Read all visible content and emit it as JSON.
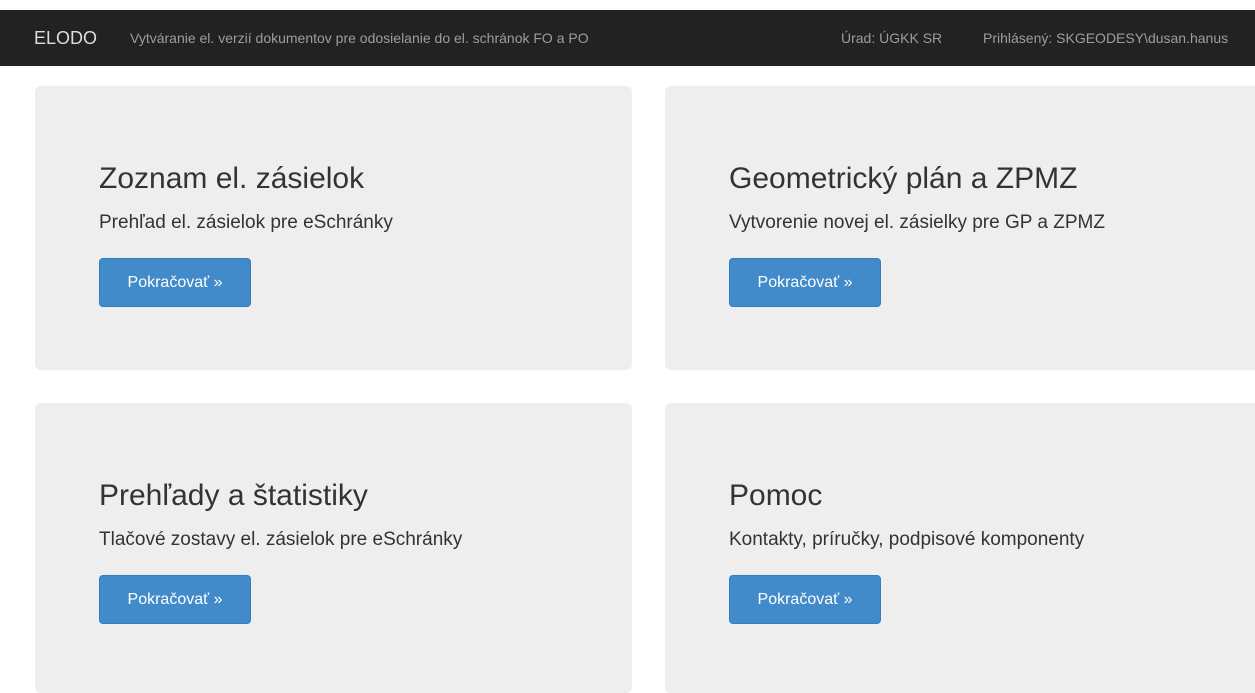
{
  "navbar": {
    "brand": "ELODO",
    "subtitle": "Vytváranie el. verzií dokumentov pre odosielanie do el. schránok FO a PO",
    "office": "Úrad: ÚGKK SR",
    "user": "Prihlásený: SKGEODESY\\dusan.hanus"
  },
  "panels": [
    {
      "title": "Zoznam el. zásielok",
      "description": "Prehľad el. zásielok pre eSchránky",
      "button": "Pokračovať »"
    },
    {
      "title": "Geometrický plán a ZPMZ",
      "description": "Vytvorenie novej el. zásielky pre GP a ZPMZ",
      "button": "Pokračovať »"
    },
    {
      "title": "Prehľady a štatistiky",
      "description": "Tlačové zostavy el. zásielok pre eSchránky",
      "button": "Pokračovať »"
    },
    {
      "title": "Pomoc",
      "description": "Kontakty, príručky, podpisové komponenty",
      "button": "Pokračovať »"
    }
  ],
  "colors": {
    "navbar_bg": "#222222",
    "panel_bg": "#eeeeee",
    "button_bg": "#428bca"
  }
}
